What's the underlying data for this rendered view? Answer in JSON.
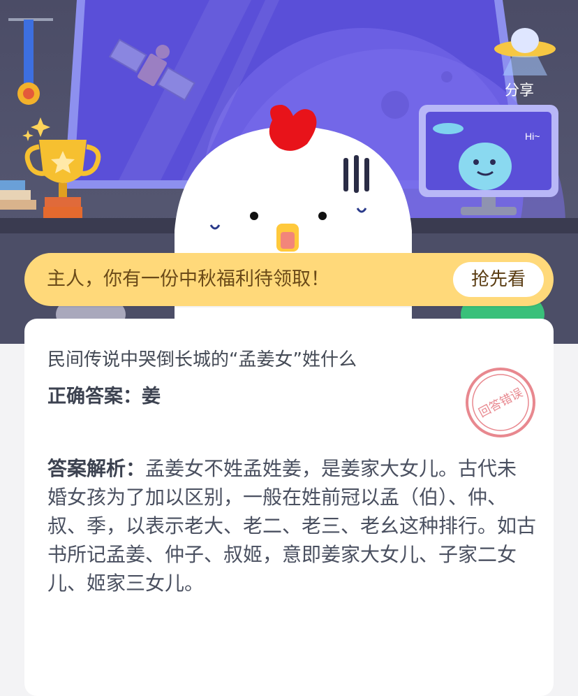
{
  "header": {
    "share_label": "分享"
  },
  "banner": {
    "message": "主人，你有一份中秋福利待领取！",
    "button_label": "抢先看"
  },
  "monitor": {
    "greeting": "Hi~"
  },
  "quiz": {
    "question": "民间传说中哭倒长城的“孟姜女”姓什么",
    "answer_label": "正确答案：",
    "answer_value": "姜",
    "stamp_text": "回答错误",
    "explanation_label": "答案解析：",
    "explanation_text": "孟姜女不姓孟姓姜，是姜家大女儿。古代未婚女孩为了加以区别，一般在姓前冠以孟（伯）、仲、叔、季，以表示老大、老二、老三、老幺这种排行。如古书所记孟姜、仲子、叔姬，意即姜家大女儿、子家二女儿、姬家三女儿。"
  },
  "colors": {
    "banner_bg": "#ffd97a",
    "banner_text": "#6a4a18",
    "stamp_red": "#e8888f",
    "space_purple": "#5b4fd6"
  }
}
